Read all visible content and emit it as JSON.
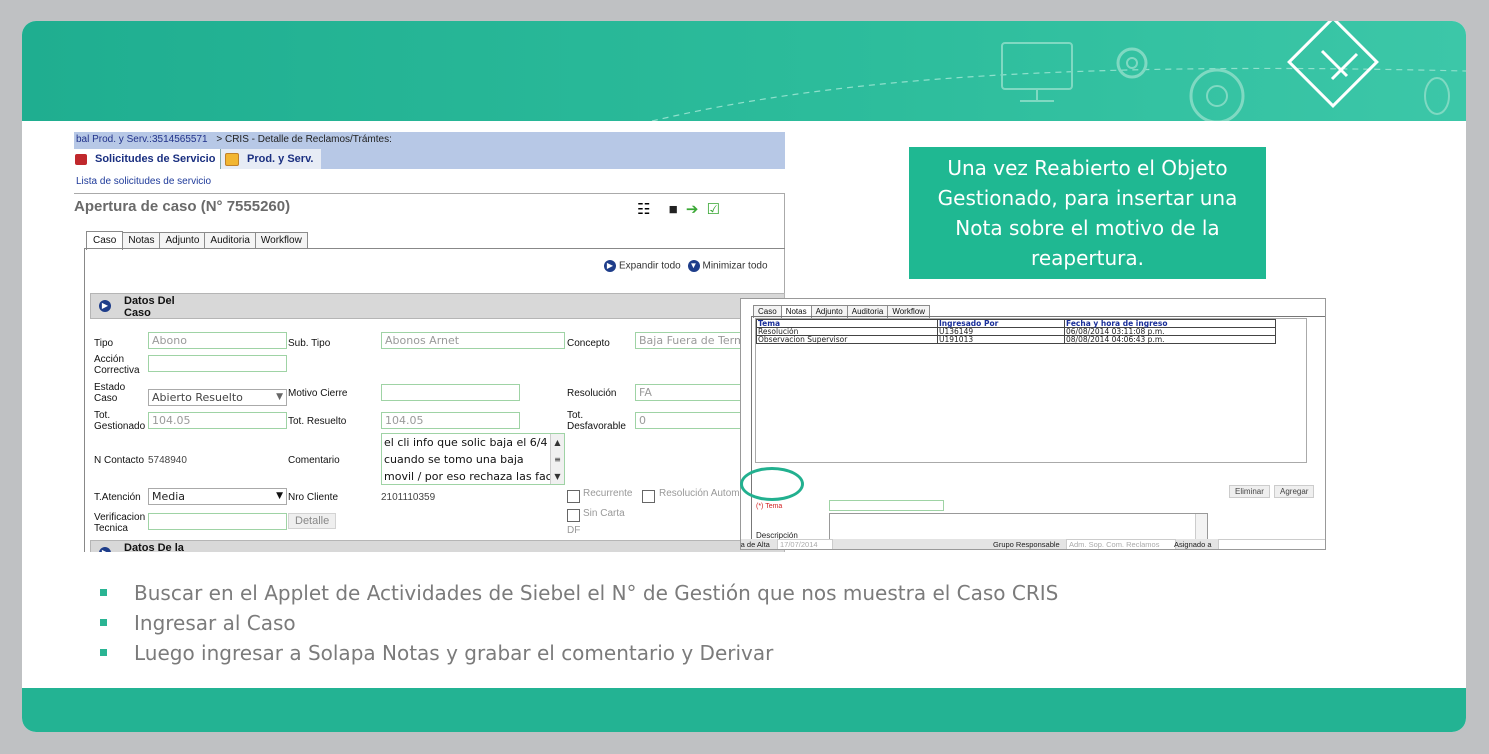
{
  "crumb": {
    "left": "bal Prod. y Serv.:3514565571",
    "right": "> CRIS - Detalle de Reclamos/Trámtes:"
  },
  "screen_tabs": [
    "Solicitudes de Servicio",
    "Prod. y Serv."
  ],
  "list_link": "Lista de solicitudes de servicio",
  "form_title": "Apertura de caso (N° 7555260)",
  "form_tabs": [
    "Caso",
    "Notas",
    "Adjunto",
    "Auditoria",
    "Workflow"
  ],
  "expand_label": "Expandir todo",
  "collapse_label": "Minimizar todo",
  "section1": "Datos Del Caso",
  "section2": "Datos De la Factura",
  "fields": {
    "tipo_label": "Tipo",
    "tipo": "Abono",
    "subtipo_label": "Sub. Tipo",
    "subtipo": "Abonos Arnet",
    "concepto_label": "Concepto",
    "concepto": "Baja Fuera de Termi",
    "accion_label": "Acción Correctiva",
    "estado_label": "Estado Caso",
    "estado": "Abierto Resuelto",
    "motivo_label": "Motivo Cierre",
    "resolucion_label": "Resolución",
    "resolucion": "FA",
    "totgest_label": "Tot. Gestionado",
    "totgest": "104.05",
    "totres_label": "Tot. Resuelto",
    "totres": "104.05",
    "totdesf_label": "Tot. Desfavorable",
    "totdesf": "0",
    "ncontacto_label": "N Contacto",
    "ncontacto": "5748940",
    "comentario_label": "Comentario",
    "comentario": [
      "el cli info que solic baja el 6/4",
      "cuando se tomo una baja",
      "movil / por eso rechaza las fact"
    ],
    "tatencion_label": "T.Atención",
    "tatencion": "Media",
    "nrocliente_label": "Nro Cliente",
    "nrocliente": "2101110359",
    "recurrente_label": "Recurrente",
    "resauto_label": "Resolución Automa",
    "verif_label": "Verificacion Tecnica",
    "detalle_btn": "Detalle",
    "sincarta_label": "Sin Carta",
    "df_label": "DF"
  },
  "notes": {
    "tabs": [
      "Caso",
      "Notas",
      "Adjunto",
      "Auditoria",
      "Workflow"
    ],
    "headers": [
      "Tema",
      "Ingresado Por",
      "Fecha y hora de ingreso"
    ],
    "rows": [
      [
        "Resolución",
        "U136149",
        "06/08/2014 03:11:08 p.m."
      ],
      [
        "Observacion Supervisor",
        "U191013",
        "08/08/2014 04:06:43 p.m."
      ]
    ],
    "eliminar": "Eliminar",
    "agregar": "Agregar",
    "tema_label": "(*) Tema",
    "desc_label": "Descripción",
    "footer": {
      "alta_label": "ia de Alta",
      "alta": "17/07/2014",
      "grupo_label": "Grupo Responsable",
      "grupo": "Adm. Sop. Com. Reclamos",
      "asignado_label": "Asignado a"
    }
  },
  "callout": [
    "Una vez Reabierto el Objeto",
    "Gestionado, para insertar una",
    "Nota sobre el motivo de la",
    "reapertura."
  ],
  "bullets": [
    "Buscar en el Applet de Actividades de Siebel  el N° de Gestión que nos muestra el Caso CRIS",
    "Ingresar al Caso",
    "Luego ingresar a Solapa Notas  y grabar el comentario y Derivar"
  ],
  "colors": {
    "accent": "#23b393",
    "callout": "#1fb892",
    "siebel_bar": "#b7c8e6",
    "link": "#1e3a9a"
  }
}
